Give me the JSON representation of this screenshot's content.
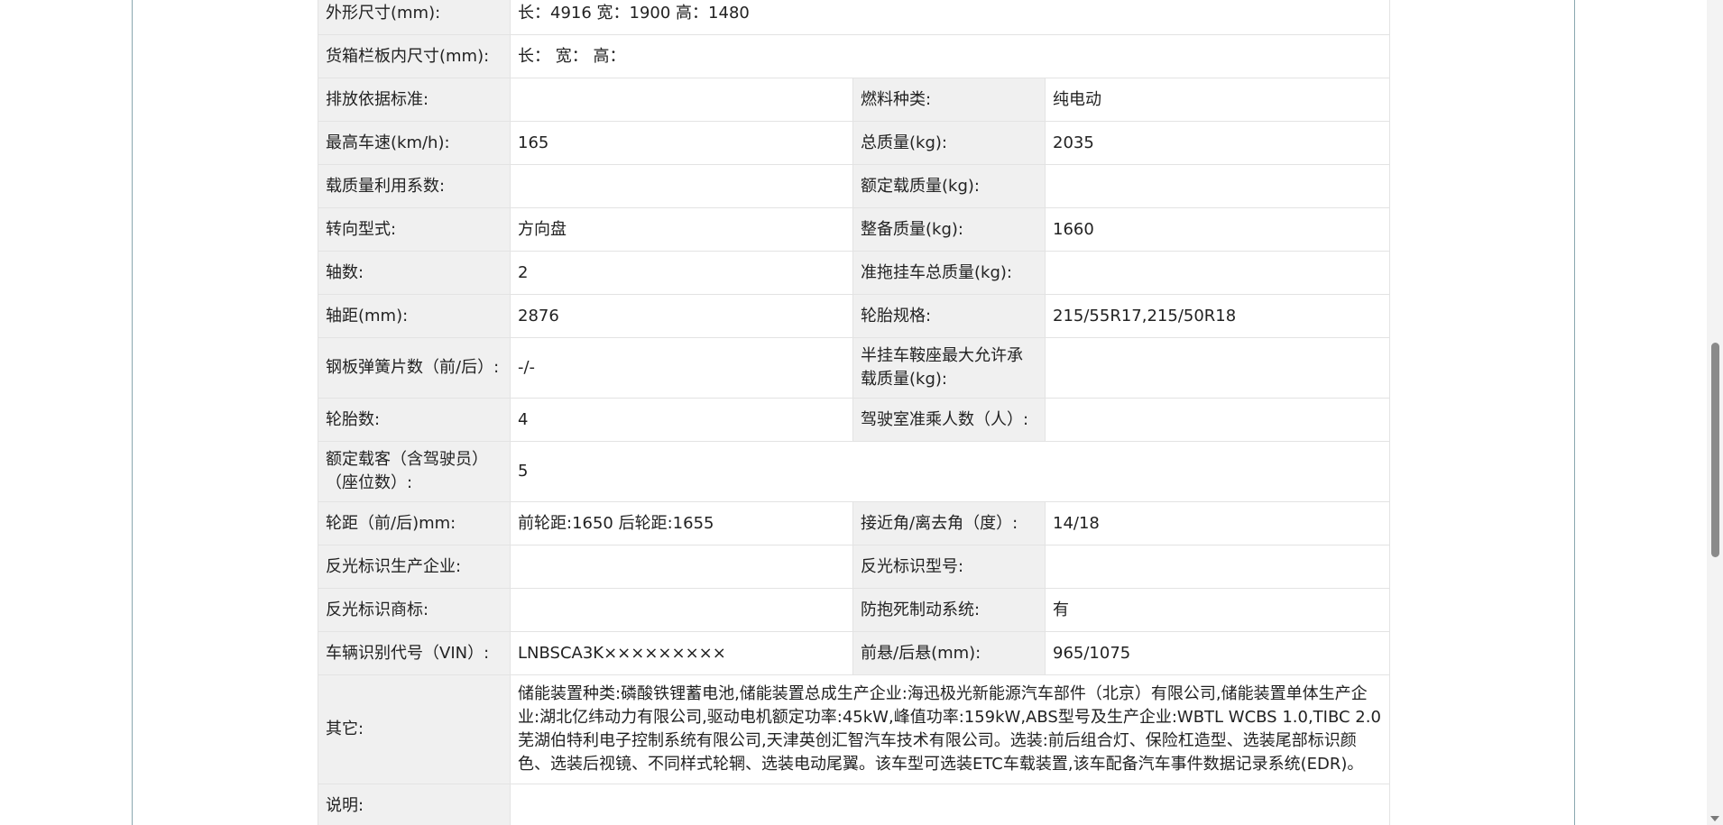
{
  "table": {
    "dimensions": {
      "label": "外形尺寸(mm):",
      "value": "长：4916 宽：1900 高：1480"
    },
    "cargo_box": {
      "label": "货箱栏板内尺寸(mm):",
      "value": "长： 宽： 高："
    },
    "emission_standard": {
      "label": "排放依据标准:",
      "value": ""
    },
    "fuel_type": {
      "label": "燃料种类:",
      "value": "纯电动"
    },
    "max_speed": {
      "label": "最高车速(km/h):",
      "value": "165"
    },
    "total_mass": {
      "label": "总质量(kg):",
      "value": "2035"
    },
    "load_utilization": {
      "label": "载质量利用系数:",
      "value": ""
    },
    "rated_load": {
      "label": "额定载质量(kg):",
      "value": ""
    },
    "steering": {
      "label": "转向型式:",
      "value": "方向盘"
    },
    "curb_mass": {
      "label": "整备质量(kg):",
      "value": "1660"
    },
    "axle_count": {
      "label": "轴数:",
      "value": "2"
    },
    "trailer_mass": {
      "label": "准拖挂车总质量(kg):",
      "value": ""
    },
    "wheelbase": {
      "label": "轴距(mm):",
      "value": "2876"
    },
    "tire_spec": {
      "label": "轮胎规格:",
      "value": "215/55R17,215/50R18"
    },
    "leaf_springs": {
      "label": "钢板弹簧片数（前/后）:",
      "value": "-/-"
    },
    "semi_trailer_saddle": {
      "label": "半挂车鞍座最大允许承载质量(kg):",
      "value": ""
    },
    "tire_count": {
      "label": "轮胎数:",
      "value": "4"
    },
    "cab_passengers": {
      "label": "驾驶室准乘人数（人）:",
      "value": ""
    },
    "rated_passengers": {
      "label": "额定载客（含驾驶员）（座位数）:",
      "value": "5"
    },
    "track": {
      "label": "轮距（前/后)mm:",
      "value": "前轮距:1650 后轮距:1655"
    },
    "approach_departure": {
      "label": "接近角/离去角（度）:",
      "value": "14/18"
    },
    "reflector_maker": {
      "label": "反光标识生产企业:",
      "value": ""
    },
    "reflector_model": {
      "label": "反光标识型号:",
      "value": ""
    },
    "reflector_brand": {
      "label": "反光标识商标:",
      "value": ""
    },
    "abs": {
      "label": "防抱死制动系统:",
      "value": "有"
    },
    "vin": {
      "label": "车辆识别代号（VIN）:",
      "value": "LNBSCA3K×××××××××"
    },
    "overhang": {
      "label": "前悬/后悬(mm):",
      "value": "965/1075"
    },
    "other": {
      "label": "其它:",
      "value": "储能装置种类:磷酸铁锂蓄电池,储能装置总成生产企业:海迅极光新能源汽车部件（北京）有限公司,储能装置单体生产企业:湖北亿纬动力有限公司,驱动电机额定功率:45kW,峰值功率:159kW,ABS型号及生产企业:WBTL WCBS 1.0,TIBC 2.0芜湖伯特利电子控制系统有限公司,天津英创汇智汽车技术有限公司。选装:前后组合灯、保险杠造型、选装尾部标识颜色、选装后视镜、不同样式轮辋、选装电动尾翼。该车型可选装ETC车载装置,该车配备汽车事件数据记录系统(EDR)。"
    },
    "notes": {
      "label": "说明:",
      "value": ""
    }
  },
  "colors": {
    "label_bg": "#f0f0f0",
    "value_bg": "#ffffff",
    "border": "#e3e3e3",
    "frame_line": "#8aa7b0"
  }
}
